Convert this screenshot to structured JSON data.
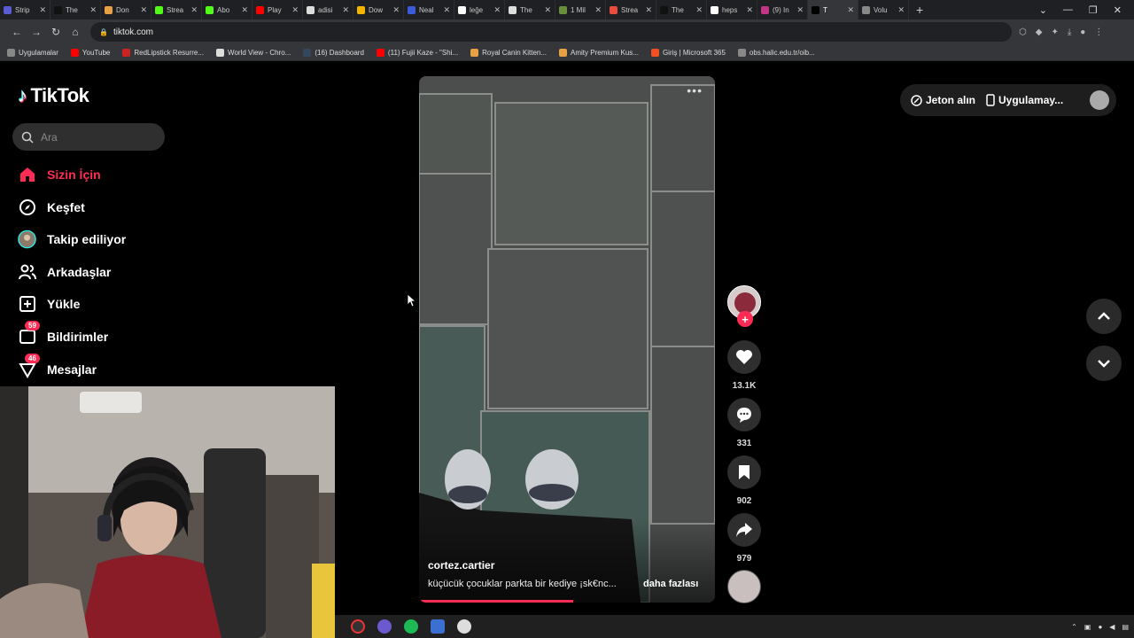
{
  "browser": {
    "tabs": [
      {
        "title": "Strip",
        "color": "#5b5bd6"
      },
      {
        "title": "The",
        "color": "#111111"
      },
      {
        "title": "Don",
        "color": "#e8a045"
      },
      {
        "title": "Strea",
        "color": "#53fc18"
      },
      {
        "title": "Abo",
        "color": "#53fc18"
      },
      {
        "title": "Play",
        "color": "#ff0000"
      },
      {
        "title": "adisi",
        "color": "#dddddd"
      },
      {
        "title": "Dow",
        "color": "#f4b400"
      },
      {
        "title": "Neal",
        "color": "#3b5bdb"
      },
      {
        "title": "leğe",
        "color": "#ffffff"
      },
      {
        "title": "The",
        "color": "#dddddd"
      },
      {
        "title": "1 Mil",
        "color": "#6a8f3a"
      },
      {
        "title": "Strea",
        "color": "#e74c3c"
      },
      {
        "title": "The",
        "color": "#111111"
      },
      {
        "title": "heps",
        "color": "#ffffff"
      },
      {
        "title": "(9) In",
        "color": "#c13584"
      },
      {
        "title": "T",
        "color": "#000000",
        "active": true
      },
      {
        "title": "Volu",
        "color": "#888888"
      }
    ],
    "url": "tiktok.com",
    "bookmarks": [
      {
        "label": "Uygulamalar",
        "color": "#888888"
      },
      {
        "label": "YouTube",
        "color": "#ff0000"
      },
      {
        "label": "RedLipstick Resurre...",
        "color": "#cc2222"
      },
      {
        "label": "World View - Chro...",
        "color": "#dddddd"
      },
      {
        "label": "(16) Dashboard",
        "color": "#36465d"
      },
      {
        "label": "(11) Fujii Kaze - \"Shi...",
        "color": "#ff0000"
      },
      {
        "label": "Royal Canin Kitten...",
        "color": "#e8a045"
      },
      {
        "label": "Amity Premium Kus...",
        "color": "#e8a045"
      },
      {
        "label": "Giriş | Microsoft 365",
        "color": "#f25022"
      },
      {
        "label": "obs.halic.edu.tr/oib...",
        "color": "#888888"
      }
    ]
  },
  "tiktok": {
    "brand": "TikTok",
    "search_placeholder": "Ara",
    "nav": [
      {
        "label": "Sizin İçin",
        "icon": "home-icon",
        "active": true
      },
      {
        "label": "Keşfet",
        "icon": "compass-icon"
      },
      {
        "label": "Takip ediliyor",
        "icon": "following-avatar-icon"
      },
      {
        "label": "Arkadaşlar",
        "icon": "friends-icon"
      },
      {
        "label": "Yükle",
        "icon": "upload-icon"
      },
      {
        "label": "Bildirimler",
        "icon": "notifications-icon",
        "badge": "59"
      },
      {
        "label": "Mesajlar",
        "icon": "messages-icon",
        "badge": "46"
      }
    ],
    "top_right": {
      "coins": "Jeton alın",
      "app": "Uygulamay..."
    },
    "video": {
      "author": "cortez.cartier",
      "caption": "küçücük çocuklar parkta bir kediye ¡sk€nc...",
      "more": "daha fazlası",
      "progress_fraction": 0.52
    },
    "actions": {
      "likes": "13.1K",
      "comments": "331",
      "saves": "902",
      "shares": "979"
    }
  },
  "colors": {
    "accent": "#fe2c55",
    "bg": "#000000"
  }
}
